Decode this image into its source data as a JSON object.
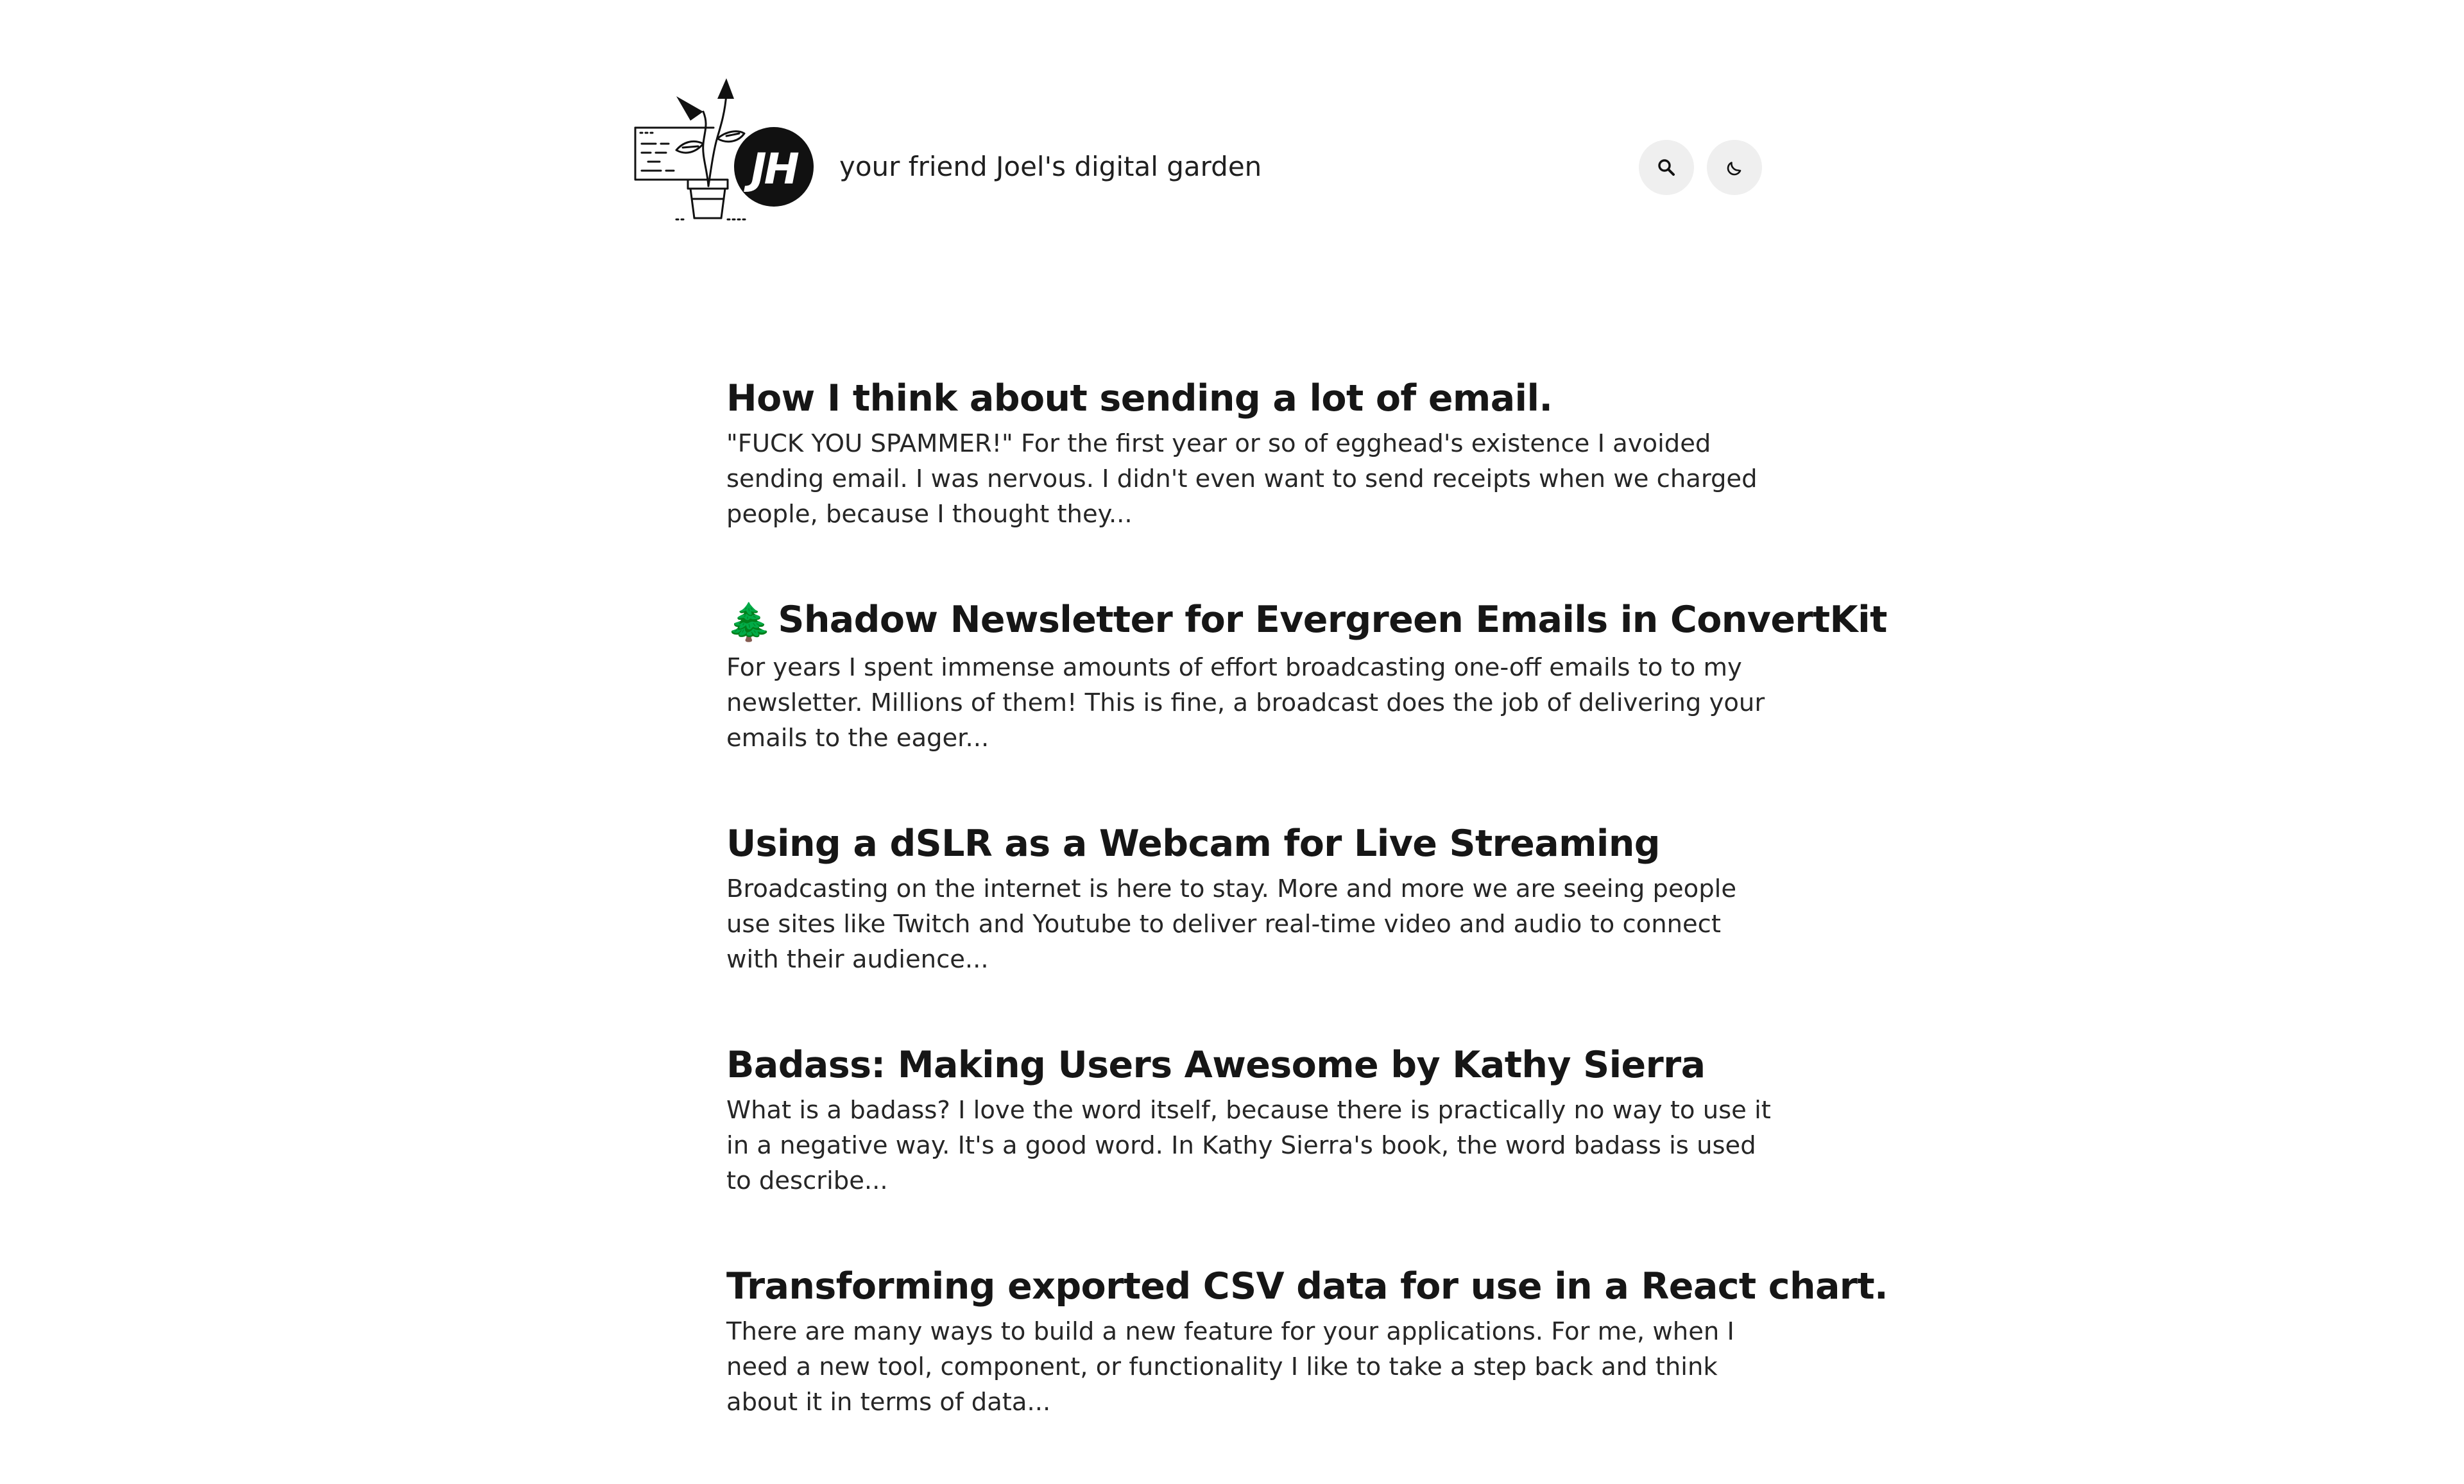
{
  "header": {
    "site_title": "your friend Joel's digital garden",
    "logo_monogram": "JH",
    "logo_icon": "plant-pot-monogram-logo",
    "search_icon": "search-icon",
    "theme_icon": "moon-icon"
  },
  "posts": [
    {
      "title": "How I think about sending a lot of email.",
      "excerpt": "\"FUCK YOU SPAMMER!\" For the first year or so of egghead's existence I avoided sending email. I was nervous. I didn't even want to send receipts when we charged people, because I thought they..."
    },
    {
      "title_emoji": "🌲",
      "title": "Shadow Newsletter for Evergreen Emails in ConvertKit",
      "excerpt": "For years I spent immense amounts of effort broadcasting one-off emails to to my newsletter. Millions of them! This is fine, a broadcast does the job of delivering your emails to the eager..."
    },
    {
      "title": "Using a dSLR as a Webcam for Live Streaming",
      "excerpt": "Broadcasting on the internet is here to stay. More and more we are seeing people use sites like Twitch and Youtube to deliver real-time video and audio to connect with their audience..."
    },
    {
      "title": "Badass: Making Users Awesome by Kathy Sierra",
      "excerpt": "What is a badass? I love the word itself, because there is practically no way to use it in a negative way. It's a good word. In Kathy Sierra's book, the word badass is used to describe..."
    },
    {
      "title": "Transforming exported CSV data for use in a React chart.",
      "excerpt": "There are many ways to build a new feature for your applications. For me, when I need a new tool, component, or functionality I like to take a step back and think about it in terms of data..."
    }
  ]
}
